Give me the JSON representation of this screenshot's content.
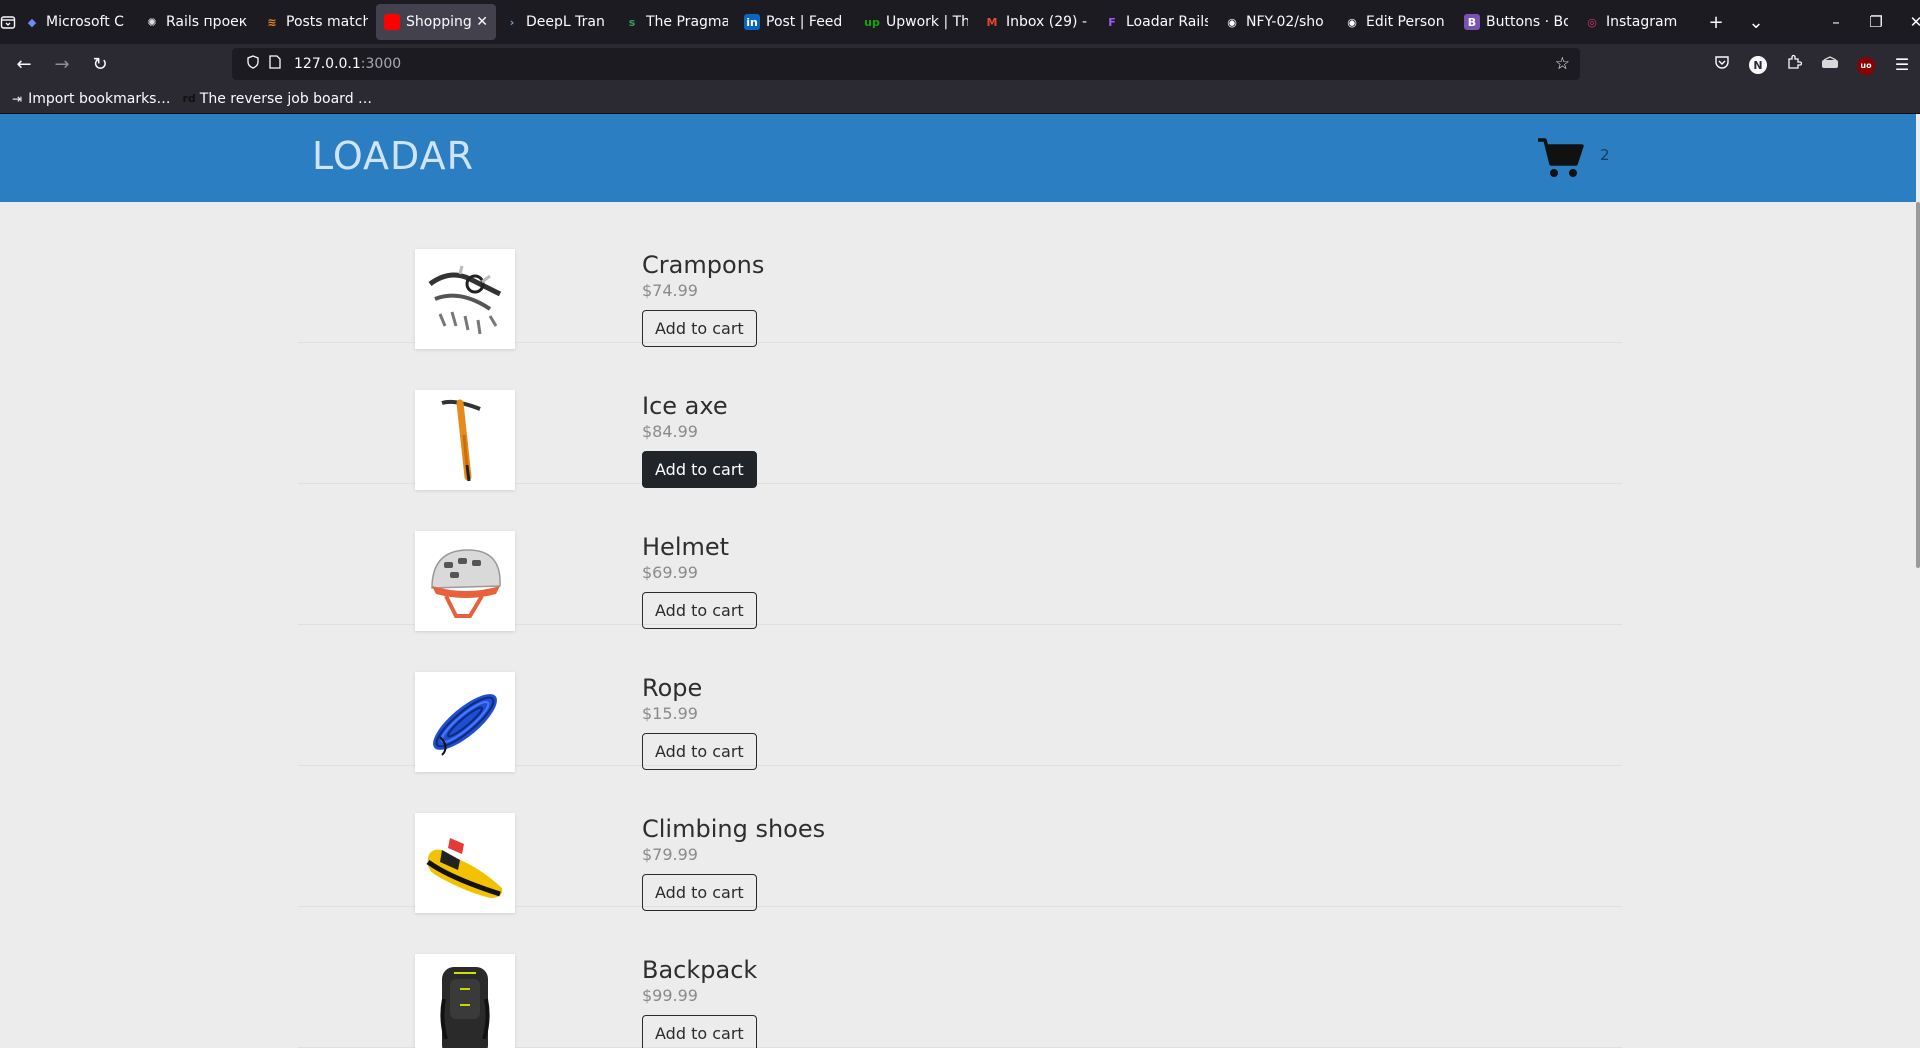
{
  "browser": {
    "tabs": [
      {
        "label": "Microsoft C",
        "icon": "copilot-icon",
        "color": "#6a8df7",
        "active": false
      },
      {
        "label": "Rails проек",
        "icon": "openai-icon",
        "color": "#e0e0e0",
        "active": false
      },
      {
        "label": "Posts match",
        "icon": "stack-icon",
        "color": "#f48024",
        "active": false
      },
      {
        "label": "Shopping",
        "icon": "red-square-icon",
        "color": "#ff0000",
        "active": true
      },
      {
        "label": "DeepL Tran",
        "icon": "deepl-icon",
        "color": "#6fa8dc",
        "active": false
      },
      {
        "label": "The Pragma",
        "icon": "substack-icon",
        "color": "#3a9d5d",
        "active": false
      },
      {
        "label": "Post | Feed",
        "icon": "linkedin-icon",
        "color": "#0a66c2",
        "active": false
      },
      {
        "label": "Upwork | Th",
        "icon": "upwork-icon",
        "color": "#14a800",
        "active": false
      },
      {
        "label": "Inbox (29) -",
        "icon": "gmail-icon",
        "color": "#ea4335",
        "active": false
      },
      {
        "label": "Loadar Rails",
        "icon": "figma-icon",
        "color": "#a259ff",
        "active": false
      },
      {
        "label": "NFY-02/sho",
        "icon": "github-icon",
        "color": "#ffffff",
        "active": false
      },
      {
        "label": "Edit Person",
        "icon": "github-icon",
        "color": "#ffffff",
        "active": false
      },
      {
        "label": "Buttons · Bo",
        "icon": "bootstrap-icon",
        "color": "#7952b3",
        "active": false
      },
      {
        "label": "Instagram",
        "icon": "instagram-icon",
        "color": "#e1306c",
        "active": false
      }
    ],
    "url_host": "127.0.0.1",
    "url_port": ":3000",
    "bookmarks": [
      {
        "label": "Import bookmarks…",
        "icon": "import-icon"
      },
      {
        "label": "The reverse job board …",
        "icon": "rd-icon"
      }
    ]
  },
  "header": {
    "brand": "LOADAR",
    "cart_count": "2",
    "brand_color": "#2a7ec1"
  },
  "products": [
    {
      "name": "Crampons",
      "price": "$74.99",
      "button": "Add to cart",
      "style": "outline",
      "image": "crampons"
    },
    {
      "name": "Ice axe",
      "price": "$84.99",
      "button": "Add to cart",
      "style": "dark",
      "image": "ice-axe"
    },
    {
      "name": "Helmet",
      "price": "$69.99",
      "button": "Add to cart",
      "style": "outline",
      "image": "helmet"
    },
    {
      "name": "Rope",
      "price": "$15.99",
      "button": "Add to cart",
      "style": "outline",
      "image": "rope"
    },
    {
      "name": "Climbing shoes",
      "price": "$79.99",
      "button": "Add to cart",
      "style": "outline",
      "image": "shoes"
    },
    {
      "name": "Backpack",
      "price": "$99.99",
      "button": "Add to cart",
      "style": "outline",
      "image": "backpack"
    }
  ]
}
